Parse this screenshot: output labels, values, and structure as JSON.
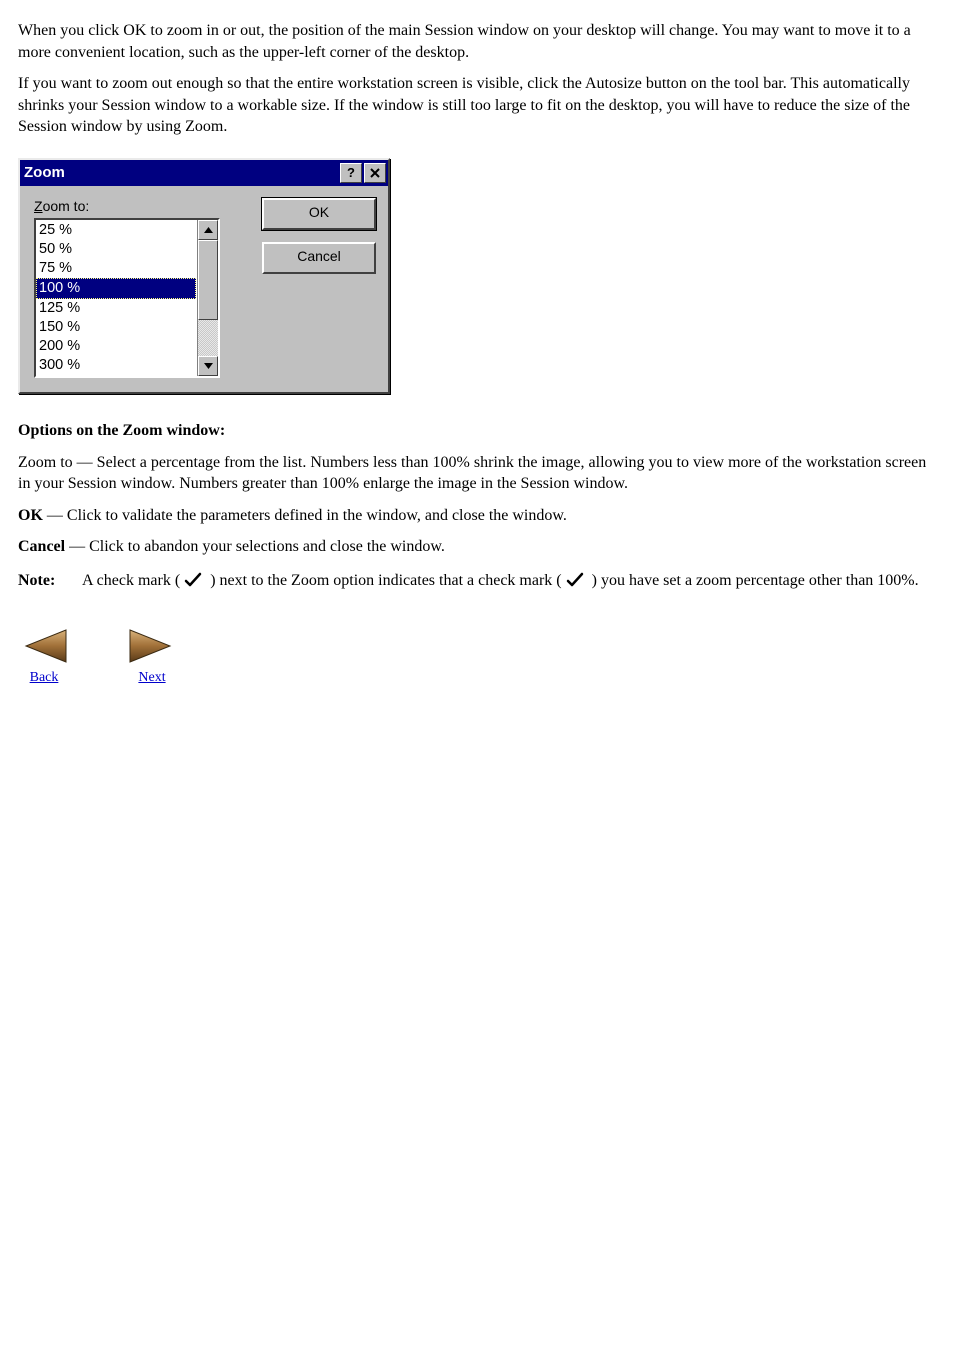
{
  "intro": {
    "p1": "When you click OK to zoom in or out, the position of the main Session window on your desktop will change. You may want to move it to a more convenient location, such as the upper-left corner of the desktop.",
    "p2": "If you want to zoom out enough so that the entire workstation screen is visible, click the Autosize button on the tool bar. This automatically shrinks your Session window to a workable size. If the window is still too large to fit on the desktop, you will have to reduce the size of the Session window by using Zoom."
  },
  "dialog": {
    "title": "Zoom",
    "label_prefix": "Z",
    "label_rest": "oom to:",
    "items": [
      "25 %",
      "50 %",
      "75 %",
      "100 %",
      "125 %",
      "150 %",
      "200 %",
      "300 %"
    ],
    "selected_index": 3,
    "ok": "OK",
    "cancel": "Cancel"
  },
  "body": {
    "heading": "Options on the Zoom window:",
    "zoom_para": "Zoom to — Select a percentage from the list. Numbers less than 100% shrink the image, allowing you to view more of the workstation screen in your Session window. Numbers greater than 100% enlarge the image in the Session window.",
    "ok_line_bold": "OK",
    "ok_line_rest": " — Click to validate the parameters defined in the window, and close the window.",
    "cancel_line_bold": "Cancel",
    "cancel_line_rest": " — Click to abandon your selections and close the window.",
    "note_label": "Note:",
    "note_text_1": "A check mark (",
    "note_text_2": ") next to the Zoom option indicates that a check mark (",
    "note_text_3": ") you have set a zoom percentage other than 100%."
  },
  "nav": {
    "back": "Back",
    "next": "Next"
  }
}
